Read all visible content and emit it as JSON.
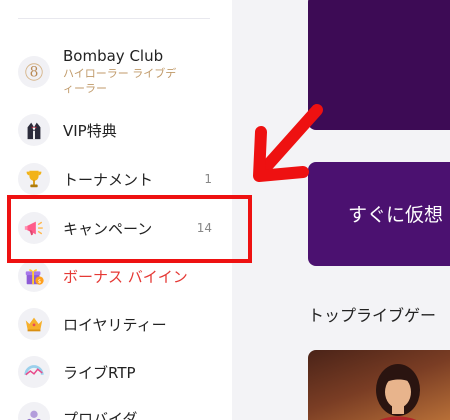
{
  "sidebar": {
    "items": [
      {
        "label": "Bombay Club",
        "sublabel": "ハイローラー ライブディーラー",
        "icon": "bombay-club-logo-icon"
      },
      {
        "label": "VIP特典",
        "icon": "tuxedo-icon"
      },
      {
        "label": "トーナメント",
        "count": "1",
        "icon": "trophy-icon"
      },
      {
        "label": "キャンペーン",
        "count": "14",
        "icon": "megaphone-icon"
      },
      {
        "label": "ボーナス バイイン",
        "icon": "gift-box-icon"
      },
      {
        "label": "ロイヤリティー",
        "icon": "crown-icon"
      },
      {
        "label": "ライブRTP",
        "icon": "rtp-gauge-icon"
      },
      {
        "label": "プロバイダ",
        "icon": "provider-icon"
      }
    ]
  },
  "main": {
    "banner_text": "すぐに仮想",
    "section_title": "トップライブゲー"
  },
  "colors": {
    "highlight_box": "#ee1111",
    "arrow": "#ee1111",
    "banner_dark": "#3d0b55",
    "banner_purple": "#4b1170",
    "bonus_text": "#e53935",
    "sublabel": "#c09a6a"
  }
}
